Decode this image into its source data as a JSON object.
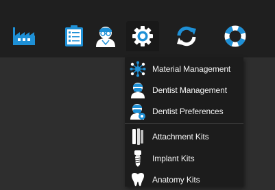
{
  "toolbar": {
    "buttons": [
      {
        "icon": "factory-icon",
        "name": "toolbar-factory-button"
      },
      {
        "icon": "clipboard-checklist-icon",
        "name": "toolbar-orders-button"
      },
      {
        "icon": "dentist-avatar-icon",
        "name": "toolbar-dentist-button"
      },
      {
        "icon": "gear-icon",
        "name": "toolbar-settings-button",
        "active": true
      },
      {
        "icon": "refresh-icon",
        "name": "toolbar-refresh-button"
      },
      {
        "icon": "lifebuoy-icon",
        "name": "toolbar-help-button"
      }
    ]
  },
  "settings_menu": {
    "items": [
      {
        "label": "Material Management",
        "icon": "molecule-icon"
      },
      {
        "label": "Dentist Management",
        "icon": "dentist-masked-icon"
      },
      {
        "label": "Dentist Preferences",
        "icon": "dentist-preferences-icon"
      },
      {
        "label": "Attachment Kits",
        "icon": "attachment-kit-icon"
      },
      {
        "label": "Implant Kits",
        "icon": "implant-icon"
      },
      {
        "label": "Anatomy Kits",
        "icon": "tooth-icon"
      }
    ]
  },
  "colors": {
    "background": "#2e2e2e",
    "topbar": "#1f1f1f",
    "menu": "#1c1c1c",
    "accent_blue": "#1e90d6",
    "icon_white": "#ffffff"
  }
}
